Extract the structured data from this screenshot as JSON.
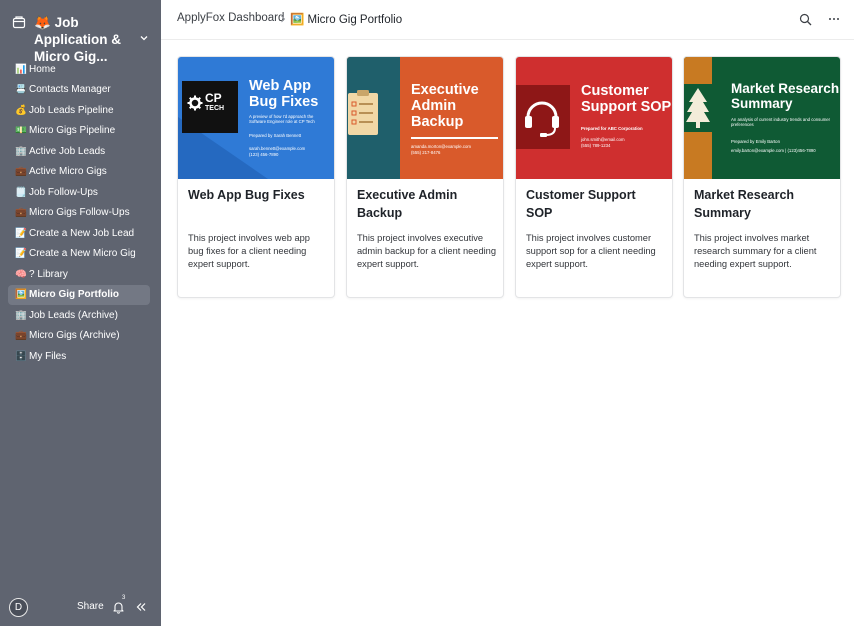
{
  "workspace": {
    "emoji": "🦊",
    "title": "Job Application & Micro Gig..."
  },
  "nav": [
    {
      "icon": "📊",
      "label": "Home"
    },
    {
      "icon": "📇",
      "label": "Contacts Manager"
    },
    {
      "icon": "💰",
      "label": "Job Leads Pipeline"
    },
    {
      "icon": "💵",
      "label": "Micro Gigs Pipeline"
    },
    {
      "icon": "🏢",
      "label": "Active Job Leads"
    },
    {
      "icon": "💼",
      "label": "Active Micro Gigs"
    },
    {
      "icon": "🗒️",
      "label": "Job Follow-Ups"
    },
    {
      "icon": "💼",
      "label": "Micro Gigs Follow-Ups"
    },
    {
      "icon": "📝",
      "label": "Create a New Job Lead"
    },
    {
      "icon": "📝",
      "label": "Create a New Micro Gig"
    },
    {
      "icon": "🧠",
      "label": "? Library"
    },
    {
      "icon": "🖼️",
      "label": "Micro Gig Portfolio",
      "active": true
    },
    {
      "icon": "🏢",
      "label": "Job Leads (Archive)"
    },
    {
      "icon": "💼",
      "label": "Micro Gigs (Archive)"
    },
    {
      "icon": "🗄️",
      "label": "My Files"
    }
  ],
  "footer": {
    "avatar_initial": "D",
    "share_label": "Share",
    "notification_count": "3"
  },
  "breadcrumb": {
    "root": "ApplyFox Dashboard",
    "current_icon": "🖼️",
    "current": "Micro Gig Portfolio"
  },
  "colors": {
    "sidebar_bg": "#5f6470",
    "card1_bg": "#2f7ad6",
    "card2_bg": "#d95a2b",
    "card2_side": "#1f5f6b",
    "card3_bg": "#cf2f2f",
    "card4_bg": "#0f5a34",
    "card4_side": "#c87a22"
  },
  "cards": [
    {
      "title": "Web App Bug Fixes",
      "description": "This project involves web app bug fixes for a client needing expert support.",
      "thumb": {
        "logo_line1": "CP",
        "logo_line2": "TECH",
        "heading_line1": "Web App",
        "heading_line2": "Bug Fixes",
        "subtitle": "A preview of how I'd approach the Software Engineer role at CP Tech",
        "prepared": "Prepared by Sarah Bennett",
        "email": "sarah.bennett@example.com",
        "phone": "(123) 456-7890"
      }
    },
    {
      "title": "Executive Admin Backup",
      "description": "This project involves executive admin backup for a client needing expert support.",
      "thumb": {
        "heading_line1": "Executive",
        "heading_line2": "Admin",
        "heading_line3": "Backup",
        "email": "amanda.morton@example.com",
        "phone": "(555) 217-8476"
      }
    },
    {
      "title": "Customer Support SOP",
      "description": "This project involves customer support sop for a client needing expert support.",
      "thumb": {
        "heading_line1": "Customer",
        "heading_line2": "Support SOP",
        "prepared": "Prepared for ABC Corporation",
        "email": "john.smith@email.com",
        "phone": "(555) 789-1234"
      }
    },
    {
      "title": "Market Research Summary",
      "description": "This project involves market research summary for a client needing expert support.",
      "thumb": {
        "heading_line1": "Market Research",
        "heading_line2": "Summary",
        "subtitle": "An analysis of current industry trends and consumer preferences",
        "prepared": "Prepared by Emily Barton",
        "contact": "emily.barton@example.com | (123)456-7890"
      }
    }
  ]
}
